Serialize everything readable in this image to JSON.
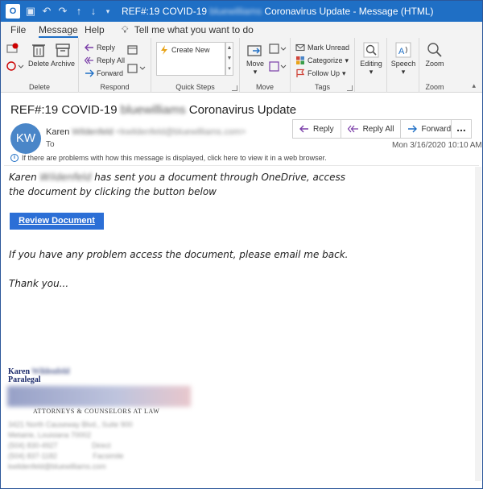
{
  "window": {
    "title_prefix": "REF#:19 COVID-19",
    "title_redacted": "bluewilliams",
    "title_suffix": "Coronavirus Update - Message (HTML)"
  },
  "menu": {
    "file": "File",
    "message": "Message",
    "help": "Help",
    "tell_me": "Tell me what you want to do"
  },
  "ribbon": {
    "delete_group": {
      "delete": "Delete",
      "archive": "Archive",
      "label": "Delete"
    },
    "respond_group": {
      "reply": "Reply",
      "reply_all": "Reply All",
      "forward": "Forward",
      "label": "Respond"
    },
    "quicksteps_group": {
      "create_new": "Create New",
      "label": "Quick Steps"
    },
    "move_group": {
      "move": "Move",
      "label": "Move"
    },
    "tags_group": {
      "mark_unread": "Mark Unread",
      "categorize": "Categorize",
      "follow_up": "Follow Up",
      "label": "Tags"
    },
    "editing": "Editing",
    "speech": "Speech",
    "zoom": "Zoom",
    "zoom_label": "Zoom"
  },
  "message": {
    "subject_prefix": "REF#:19 COVID-19",
    "subject_redacted": "bluewilliams",
    "subject_suffix": "Coronavirus Update",
    "avatar_initials": "KW",
    "sender_name": "Karen",
    "sender_redacted": "Wildenfeld",
    "sender_email": "<kwildenfeld@bluewilliams.com>",
    "to_label": "To",
    "date": "Mon 3/16/2020 10:10 AM",
    "info_bar": "If there are problems with how this message is displayed, click here to view it in a web browser.",
    "actions": {
      "reply": "Reply",
      "reply_all": "Reply All",
      "forward": "Forward",
      "more": "..."
    }
  },
  "body": {
    "line1_name": "Karen",
    "line1_redacted": "Wildenfeld",
    "line1_rest": "has sent you a document through OneDrive, access",
    "line2": "the document by clicking the button below",
    "button": "Review Document",
    "line3": "If you have any problem access the document, please email me back.",
    "line4": "Thank you..."
  },
  "signature": {
    "name": "Karen",
    "name_redacted": "Wildenfeld",
    "title": "Paralegal",
    "firm": "ATTORNEYS & COUNSELORS AT LAW",
    "address1": "3421 North Causeway Blvd., Suite 900",
    "address2": "Metairie, Louisiana 70002",
    "phone_direct": "(504) 830-4927",
    "phone_direct_label": "Direct",
    "phone_fax": "(504) 837-1182",
    "phone_fax_label": "Facsimile",
    "email": "kwildenfeld@bluewilliams.com"
  },
  "colors": {
    "titlebar": "#1f6fc5",
    "button": "#2c6fd6",
    "avatar": "#4a86c8"
  }
}
